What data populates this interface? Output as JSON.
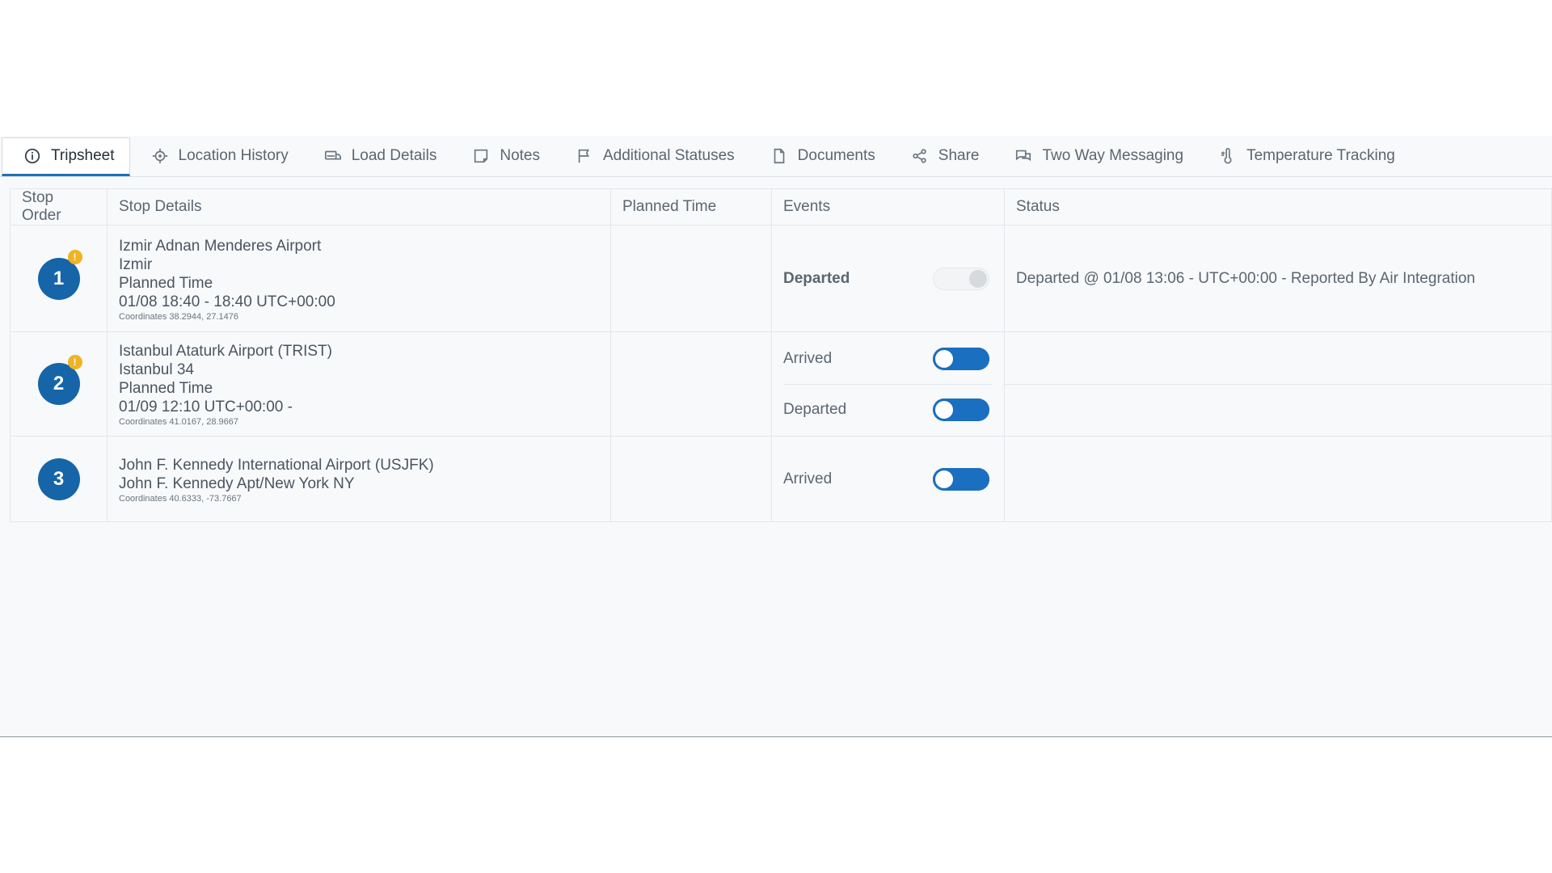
{
  "tabs": [
    {
      "label": "Tripsheet",
      "icon": "info-icon",
      "active": true
    },
    {
      "label": "Location History",
      "icon": "crosshair-icon"
    },
    {
      "label": "Load Details",
      "icon": "truck-icon"
    },
    {
      "label": "Notes",
      "icon": "note-icon"
    },
    {
      "label": "Additional Statuses",
      "icon": "flag-icon"
    },
    {
      "label": "Documents",
      "icon": "document-icon"
    },
    {
      "label": "Share",
      "icon": "share-icon"
    },
    {
      "label": "Two Way Messaging",
      "icon": "chat-icon"
    },
    {
      "label": "Temperature Tracking",
      "icon": "thermometer-icon"
    }
  ],
  "table": {
    "headers": {
      "stop_order": "Stop Order",
      "stop_details": "Stop Details",
      "planned_time": "Planned Time",
      "events": "Events",
      "status": "Status"
    },
    "rows": [
      {
        "order": "1",
        "alert": "!",
        "name": "Izmir Adnan Menderes Airport",
        "city": "Izmir",
        "planned_label": "Planned Time",
        "planned_value": "01/08 18:40 - 18:40 UTC+00:00",
        "coords": "Coordinates  38.2944, 27.1476",
        "events": [
          {
            "label": "Departed",
            "enabled": false,
            "bold": true,
            "status": "Departed @ 01/08 13:06 - UTC+00:00 - Reported By Air Integration"
          }
        ]
      },
      {
        "order": "2",
        "alert": "!",
        "name": "Istanbul Ataturk Airport (TRIST)",
        "city": "Istanbul 34",
        "planned_label": "Planned Time",
        "planned_value": "01/09 12:10 UTC+00:00 -",
        "coords": "Coordinates  41.0167, 28.9667",
        "events": [
          {
            "label": "Arrived",
            "enabled": true,
            "bold": false,
            "status": ""
          },
          {
            "label": "Departed",
            "enabled": true,
            "bold": false,
            "status": ""
          }
        ]
      },
      {
        "order": "3",
        "alert": "",
        "name": "John F. Kennedy International Airport (USJFK)",
        "city": "John F. Kennedy Apt/New York NY",
        "planned_label": "",
        "planned_value": "",
        "coords": "Coordinates  40.6333, -73.7667",
        "events": [
          {
            "label": "Arrived",
            "enabled": true,
            "bold": false,
            "status": ""
          }
        ]
      }
    ]
  },
  "colors": {
    "accent": "#1f72b8",
    "badge": "#1565a8",
    "alert": "#f0b323",
    "toggle_on": "#1a6fc0"
  }
}
